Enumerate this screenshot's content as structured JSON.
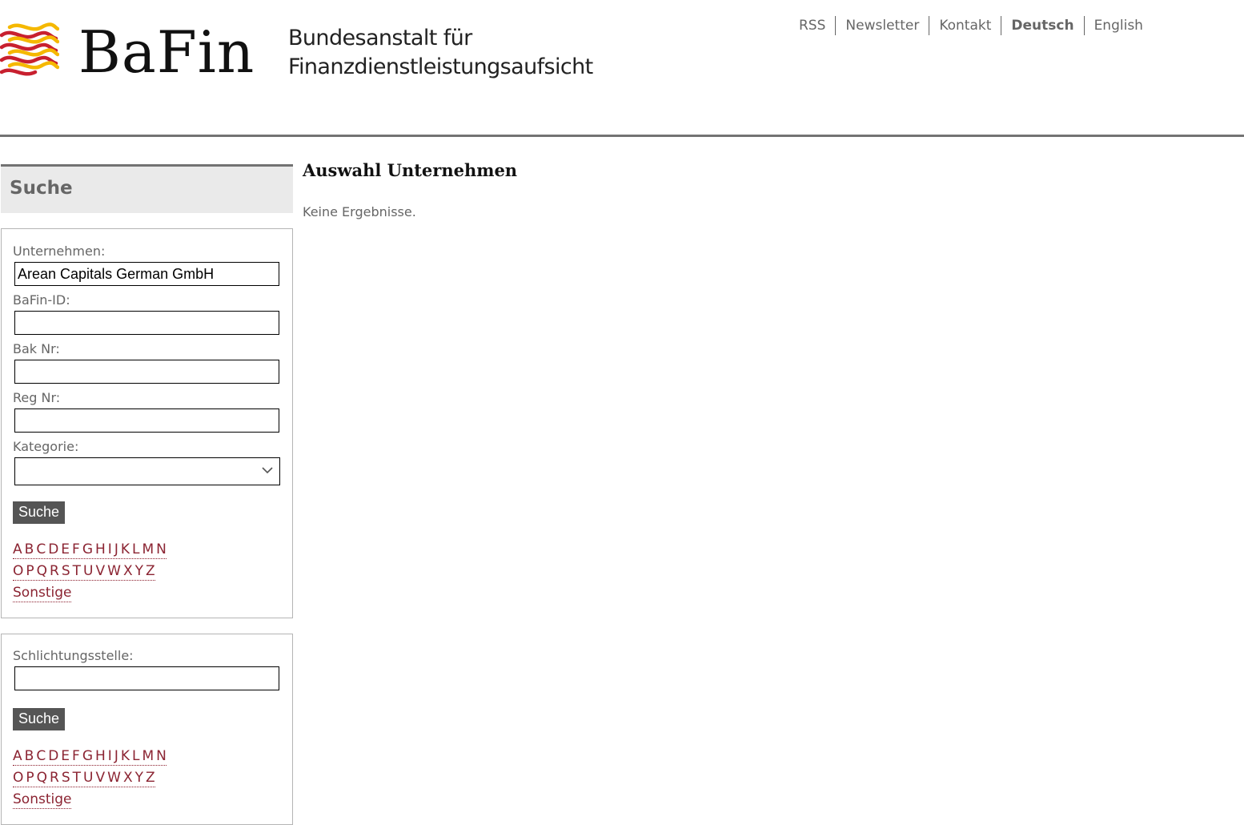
{
  "header": {
    "logo_text": "BaFin",
    "org_name_line1": "Bundesanstalt für",
    "org_name_line2": "Finanzdienstleistungsaufsicht",
    "logo_colors": {
      "red": "#c8202f",
      "yellow": "#f5b800"
    },
    "nav": [
      {
        "label": "RSS",
        "active": false
      },
      {
        "label": "Newsletter",
        "active": false
      },
      {
        "label": "Kontakt",
        "active": false
      },
      {
        "label": "Deutsch",
        "active": true
      },
      {
        "label": "English",
        "active": false
      }
    ]
  },
  "sidebar": {
    "title": "Suche",
    "company_search": {
      "fields": [
        {
          "label": "Unternehmen:",
          "value": "Arean Capitals German GmbH",
          "placeholder": ""
        },
        {
          "label": "BaFin-ID:",
          "value": "",
          "placeholder": ""
        },
        {
          "label": "Bak Nr:",
          "value": "",
          "placeholder": ""
        },
        {
          "label": "Reg Nr:",
          "value": "",
          "placeholder": ""
        }
      ],
      "category_label": "Kategorie:",
      "category_selected": "",
      "button_label": "Suche",
      "alphabet_row1": [
        "A",
        "B",
        "C",
        "D",
        "E",
        "F",
        "G",
        "H",
        "I",
        "J",
        "K",
        "L",
        "M",
        "N"
      ],
      "alphabet_row2": [
        "O",
        "P",
        "Q",
        "R",
        "S",
        "T",
        "U",
        "V",
        "W",
        "X",
        "Y",
        "Z"
      ],
      "other_label": "Sonstige"
    },
    "arbitration_search": {
      "label": "Schlichtungsstelle:",
      "value": "",
      "button_label": "Suche",
      "alphabet_row1": [
        "A",
        "B",
        "C",
        "D",
        "E",
        "F",
        "G",
        "H",
        "I",
        "J",
        "K",
        "L",
        "M",
        "N"
      ],
      "alphabet_row2": [
        "O",
        "P",
        "Q",
        "R",
        "S",
        "T",
        "U",
        "V",
        "W",
        "X",
        "Y",
        "Z"
      ],
      "other_label": "Sonstige"
    }
  },
  "main": {
    "heading": "Auswahl Unternehmen",
    "message": "Keine Ergebnisse."
  },
  "colors": {
    "link": "#8b2432",
    "rule": "#737373",
    "button": "#555555"
  }
}
